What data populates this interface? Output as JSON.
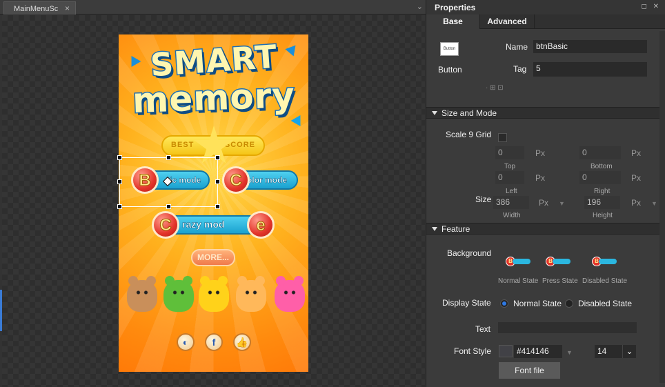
{
  "editor": {
    "tab_label": "MainMenuSc",
    "tab_close": "×",
    "tab_menu": "⌄"
  },
  "game": {
    "logo_line1": "SMART",
    "logo_line2": "memory",
    "best_left": "BEST",
    "best_right": "SCORE",
    "basic_letter": "B",
    "basic_label": "ic mode",
    "color_letter": "C",
    "color_label": "olor mode",
    "crazy_letter": "C",
    "crazy_label": "razy mod",
    "crazy_end_letter": "e",
    "more_label": "MORE...",
    "facebook_label": "f"
  },
  "props": {
    "title": "Properties",
    "window_controls": "◻ ✕",
    "tabs": [
      "Base",
      "Advanced"
    ],
    "widget_thumb": "Button",
    "widget_type": "Button",
    "name_label": "Name",
    "name_value": "btnBasic",
    "tag_label": "Tag",
    "tag_value": "5",
    "section_size": "Size and Mode",
    "scale9_label": "Scale 9 Grid",
    "top_value": "0",
    "top_label": "Top",
    "bottom_value": "0",
    "bottom_label": "Bottom",
    "left_value": "0",
    "left_label": "Left",
    "right_value": "0",
    "right_label": "Right",
    "unit_px": "Px",
    "size_label": "Size",
    "width_value": "386",
    "width_label": "Width",
    "height_value": "196",
    "height_label": "Height",
    "section_feature": "Feature",
    "background_label": "Background",
    "normal_state": "Normal State",
    "press_state": "Press State",
    "disabled_state": "Disabled State",
    "display_state_label": "Display State",
    "display_normal": "Normal State",
    "display_disabled": "Disabled State",
    "text_label": "Text",
    "text_value": "",
    "font_style_label": "Font Style",
    "font_color": "#414146",
    "font_size": "14",
    "font_file_label": "Font file"
  },
  "colors": {
    "panel_bg": "#3b3b3b",
    "accent_blue": "#2f7ae5",
    "game_orange": "#ff8a0e",
    "pill_blue": "#1aa1cf",
    "ball_red": "#e3342a"
  }
}
